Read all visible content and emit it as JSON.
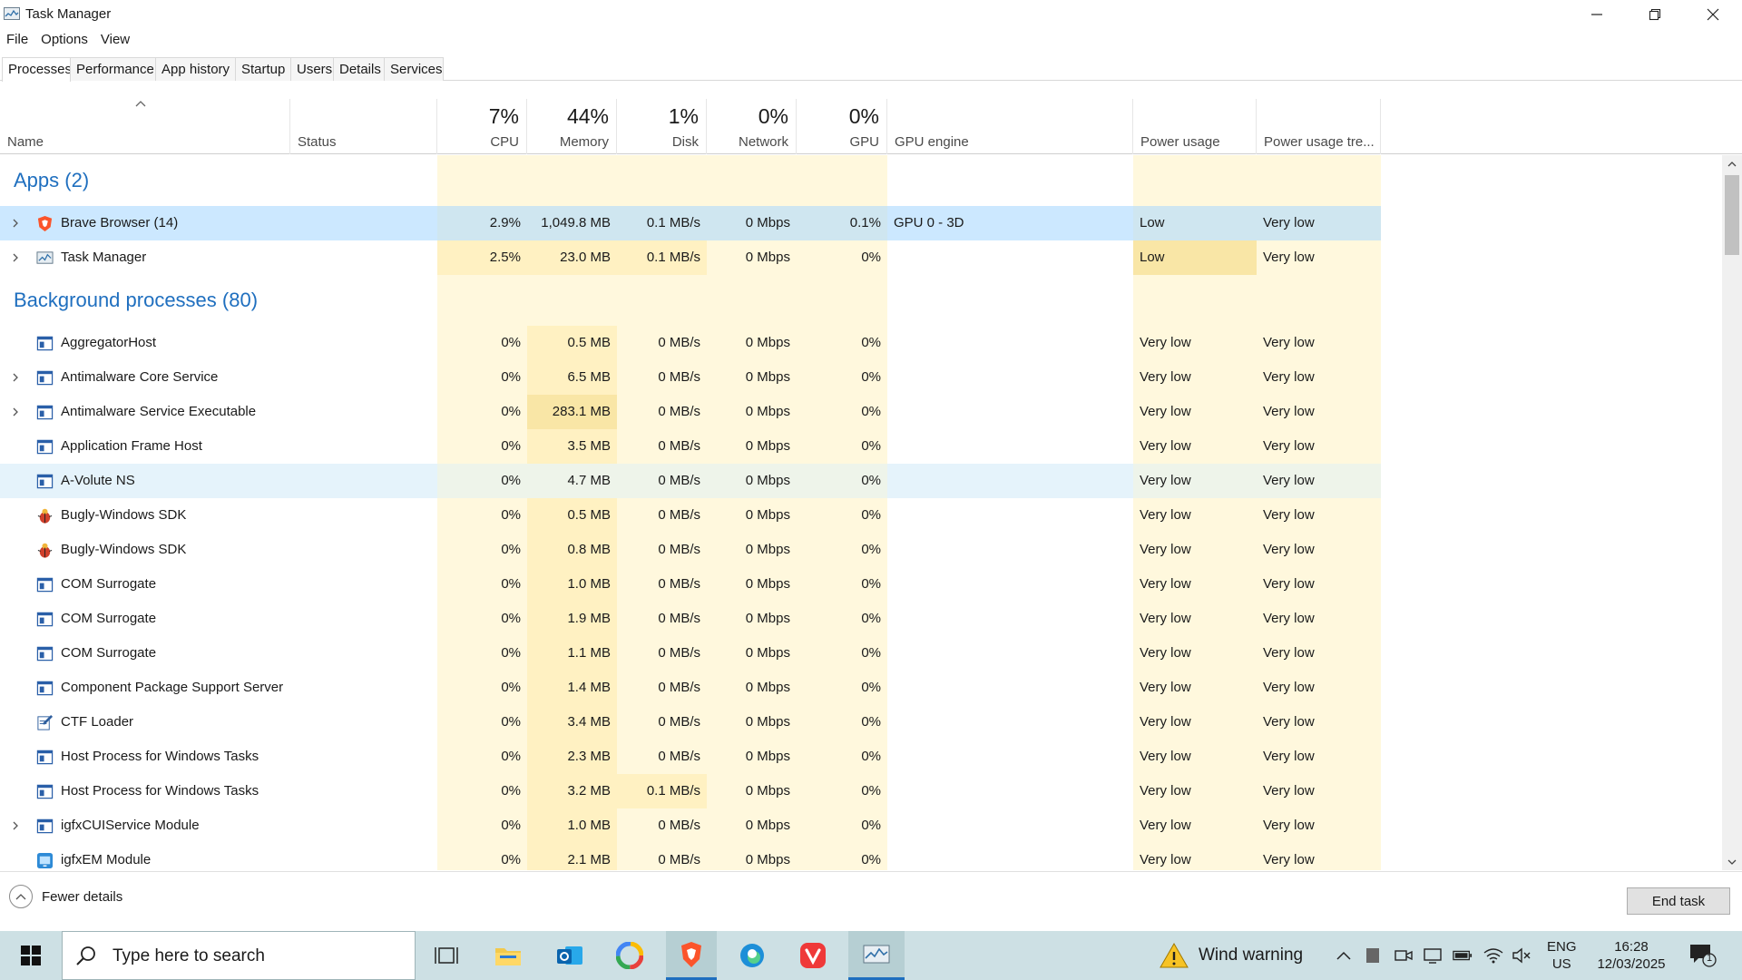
{
  "window": {
    "title": "Task Manager",
    "controls": [
      "minimize",
      "restore",
      "close"
    ]
  },
  "menu": [
    "File",
    "Options",
    "View"
  ],
  "tabs": [
    "Processes",
    "Performance",
    "App history",
    "Startup",
    "Users",
    "Details",
    "Services"
  ],
  "active_tab": "Processes",
  "columns": {
    "name": "Name",
    "status": "Status",
    "cpu": {
      "pct": "7%",
      "label": "CPU"
    },
    "memory": {
      "pct": "44%",
      "label": "Memory"
    },
    "disk": {
      "pct": "1%",
      "label": "Disk"
    },
    "network": {
      "pct": "0%",
      "label": "Network"
    },
    "gpu": {
      "pct": "0%",
      "label": "GPU"
    },
    "gpu_engine": "GPU engine",
    "power": "Power usage",
    "power_trend": "Power usage tre..."
  },
  "groups": {
    "apps": "Apps (2)",
    "background": "Background processes (80)"
  },
  "apps": [
    {
      "name": "Brave Browser (14)",
      "icon": "brave-icon",
      "expandable": true,
      "selected": true,
      "cpu": "2.9%",
      "memory": "1,049.8 MB",
      "disk": "0.1 MB/s",
      "network": "0 Mbps",
      "gpu": "0.1%",
      "gpu_engine": "GPU 0 - 3D",
      "power": "Low",
      "power_trend": "Very low"
    },
    {
      "name": "Task Manager",
      "icon": "task-manager-icon",
      "expandable": true,
      "selected": false,
      "cpu": "2.5%",
      "memory": "23.0 MB",
      "disk": "0.1 MB/s",
      "network": "0 Mbps",
      "gpu": "0%",
      "gpu_engine": "",
      "power": "Low",
      "power_trend": "Very low"
    }
  ],
  "background": [
    {
      "name": "AggregatorHost",
      "icon": "window-process-icon",
      "expandable": false,
      "cpu": "0%",
      "memory": "0.5 MB",
      "disk": "0 MB/s",
      "network": "0 Mbps",
      "gpu": "0%",
      "power": "Very low",
      "power_trend": "Very low"
    },
    {
      "name": "Antimalware Core Service",
      "icon": "window-process-icon",
      "expandable": true,
      "cpu": "0%",
      "memory": "6.5 MB",
      "disk": "0 MB/s",
      "network": "0 Mbps",
      "gpu": "0%",
      "power": "Very low",
      "power_trend": "Very low"
    },
    {
      "name": "Antimalware Service Executable",
      "icon": "window-process-icon",
      "expandable": true,
      "cpu": "0%",
      "memory": "283.1 MB",
      "disk": "0 MB/s",
      "network": "0 Mbps",
      "gpu": "0%",
      "power": "Very low",
      "power_trend": "Very low"
    },
    {
      "name": "Application Frame Host",
      "icon": "window-process-icon",
      "expandable": false,
      "cpu": "0%",
      "memory": "3.5 MB",
      "disk": "0 MB/s",
      "network": "0 Mbps",
      "gpu": "0%",
      "power": "Very low",
      "power_trend": "Very low"
    },
    {
      "name": "A-Volute NS",
      "icon": "window-process-icon",
      "expandable": false,
      "hover": true,
      "cpu": "0%",
      "memory": "4.7 MB",
      "disk": "0 MB/s",
      "network": "0 Mbps",
      "gpu": "0%",
      "power": "Very low",
      "power_trend": "Very low"
    },
    {
      "name": "Bugly-Windows SDK",
      "icon": "bug-icon",
      "expandable": false,
      "cpu": "0%",
      "memory": "0.5 MB",
      "disk": "0 MB/s",
      "network": "0 Mbps",
      "gpu": "0%",
      "power": "Very low",
      "power_trend": "Very low"
    },
    {
      "name": "Bugly-Windows SDK",
      "icon": "bug-icon",
      "expandable": false,
      "cpu": "0%",
      "memory": "0.8 MB",
      "disk": "0 MB/s",
      "network": "0 Mbps",
      "gpu": "0%",
      "power": "Very low",
      "power_trend": "Very low"
    },
    {
      "name": "COM Surrogate",
      "icon": "window-process-icon",
      "expandable": false,
      "cpu": "0%",
      "memory": "1.0 MB",
      "disk": "0 MB/s",
      "network": "0 Mbps",
      "gpu": "0%",
      "power": "Very low",
      "power_trend": "Very low"
    },
    {
      "name": "COM Surrogate",
      "icon": "window-process-icon",
      "expandable": false,
      "cpu": "0%",
      "memory": "1.9 MB",
      "disk": "0 MB/s",
      "network": "0 Mbps",
      "gpu": "0%",
      "power": "Very low",
      "power_trend": "Very low"
    },
    {
      "name": "COM Surrogate",
      "icon": "window-process-icon",
      "expandable": false,
      "cpu": "0%",
      "memory": "1.1 MB",
      "disk": "0 MB/s",
      "network": "0 Mbps",
      "gpu": "0%",
      "power": "Very low",
      "power_trend": "Very low"
    },
    {
      "name": "Component Package Support Server",
      "icon": "window-process-icon",
      "expandable": false,
      "cpu": "0%",
      "memory": "1.4 MB",
      "disk": "0 MB/s",
      "network": "0 Mbps",
      "gpu": "0%",
      "power": "Very low",
      "power_trend": "Very low"
    },
    {
      "name": "CTF Loader",
      "icon": "pen-note-icon",
      "expandable": false,
      "cpu": "0%",
      "memory": "3.4 MB",
      "disk": "0 MB/s",
      "network": "0 Mbps",
      "gpu": "0%",
      "power": "Very low",
      "power_trend": "Very low"
    },
    {
      "name": "Host Process for Windows Tasks",
      "icon": "window-process-icon",
      "expandable": false,
      "cpu": "0%",
      "memory": "2.3 MB",
      "disk": "0 MB/s",
      "network": "0 Mbps",
      "gpu": "0%",
      "power": "Very low",
      "power_trend": "Very low"
    },
    {
      "name": "Host Process for Windows Tasks",
      "icon": "window-process-icon",
      "expandable": false,
      "cpu": "0%",
      "memory": "3.2 MB",
      "disk": "0.1 MB/s",
      "network": "0 Mbps",
      "gpu": "0%",
      "power": "Very low",
      "power_trend": "Very low"
    },
    {
      "name": "igfxCUIService Module",
      "icon": "window-process-icon",
      "expandable": true,
      "cpu": "0%",
      "memory": "1.0 MB",
      "disk": "0 MB/s",
      "network": "0 Mbps",
      "gpu": "0%",
      "power": "Very low",
      "power_trend": "Very low"
    },
    {
      "name": "igfxEM Module",
      "icon": "intel-graphics-icon",
      "expandable": false,
      "cpu": "0%",
      "memory": "2.1 MB",
      "disk": "0 MB/s",
      "network": "0 Mbps",
      "gpu": "0%",
      "power": "Very low",
      "power_trend": "Very low"
    }
  ],
  "footer": {
    "fewer_details": "Fewer details",
    "end_task": "End task"
  },
  "taskbar": {
    "search_placeholder": "Type here to search",
    "weather_text": "Wind warning",
    "lang_line1": "ENG",
    "lang_line2": "US",
    "time": "16:28",
    "date": "12/03/2025",
    "notification_count": "1",
    "pinned": [
      "task-view-icon",
      "file-explorer-icon",
      "outlook-icon",
      "colorful-app-icon",
      "brave-icon",
      "edge-icon",
      "vivaldi-icon",
      "task-manager-icon"
    ]
  },
  "colors": {
    "heat_light": "#fff8dd",
    "heat_medium": "#fff1c2",
    "heat_strong": "#f9e6a6",
    "selected": "#cce8ff",
    "selected_heat": "#cfe6f0",
    "hover": "#e5f3fb",
    "group_blue": "#1f6fbf",
    "taskbar": "#cde0e4"
  }
}
